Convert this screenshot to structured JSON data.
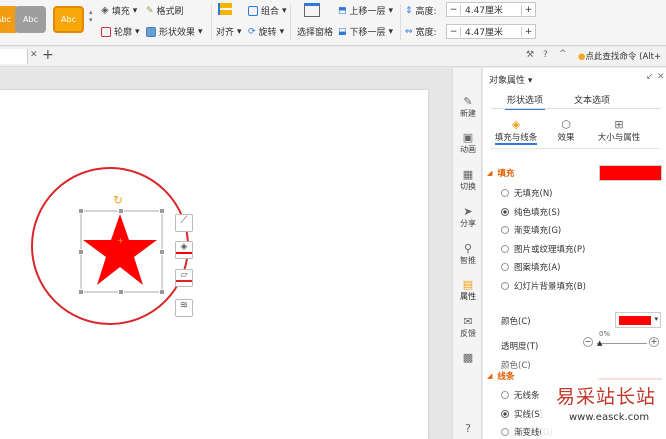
{
  "ribbon": {
    "swatches": [
      {
        "label": "Abc",
        "color": "#f39c12"
      },
      {
        "label": "Abc",
        "color": "#9e9e9e"
      },
      {
        "label": "Abc",
        "color": "#f7a70a"
      }
    ],
    "fill_label": "填充",
    "format_painter_label": "格式刷",
    "outline_label": "轮廓",
    "shape_effect_label": "形状效果",
    "align_label": "对齐",
    "group_label": "组合",
    "rotate_label": "旋转",
    "selection_pane_label": "选择窗格",
    "bring_forward_label": "上移一层",
    "send_backward_label": "下移一层",
    "height_label": "高度:",
    "height_value": "4.47厘米",
    "width_label": "宽度:",
    "width_value": "4.47厘米",
    "minus": "−",
    "plus": "+",
    "search_command": "点此查找命令 (Alt+"
  },
  "tabs": {
    "add": "+"
  },
  "side": {
    "items": [
      {
        "label": "新建",
        "icon": "pencil-icon"
      },
      {
        "label": "动画",
        "icon": "animation-icon"
      },
      {
        "label": "切换",
        "icon": "transition-icon"
      },
      {
        "label": "分享",
        "icon": "share-icon"
      },
      {
        "label": "智推",
        "icon": "smart-icon"
      },
      {
        "label": "属性",
        "icon": "property-icon"
      },
      {
        "label": "反馈",
        "icon": "feedback-icon"
      }
    ]
  },
  "panel": {
    "title": "对象属性 ▾",
    "tab_shape": "形状选项",
    "tab_text": "文本选项",
    "sub_fill_line": "填充与线条",
    "sub_effect": "效果",
    "sub_size": "大小与属性",
    "fill_section": "填充",
    "fill_color": "#ff0000",
    "options": [
      "无填充(N)",
      "纯色填充(S)",
      "渐变填充(G)",
      "图片或纹理填充(P)",
      "图案填充(A)",
      "幻灯片背景填充(B)"
    ],
    "selected_option": 1,
    "color_label": "颜色(C)",
    "transparency_label": "透明度(T)",
    "transparency_value": "0%",
    "color2_label": "颜色(C)",
    "line_section": "线条",
    "line_options": [
      "无线条",
      "实线(S)",
      "渐变线(G)"
    ]
  },
  "watermark": {
    "title": "易采站长站",
    "url": "www.easck.com"
  },
  "colors": {
    "red": "#ff0000",
    "circle": "#d9262b"
  }
}
